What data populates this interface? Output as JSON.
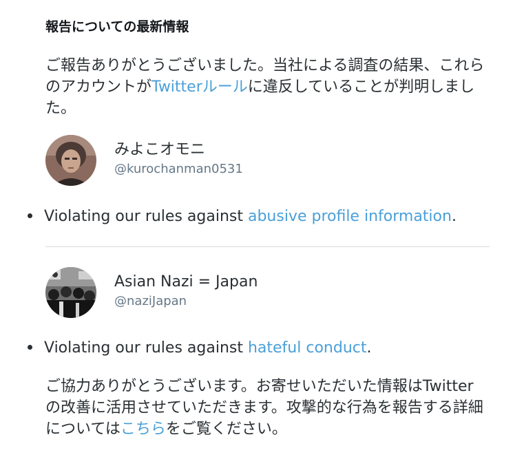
{
  "title": "報告についての最新情報",
  "intro": {
    "before_link": "ご報告ありがとうございました。当社による調査の結果、これらのアカウントが",
    "link": "Twitterルール",
    "after_link": "に違反していることが判明しました。"
  },
  "accounts": [
    {
      "display_name": "みよこオモニ",
      "handle": "@kurochanman0531",
      "violation_prefix": "Violating our rules against ",
      "violation_link": "abusive profile information",
      "violation_suffix": "."
    },
    {
      "display_name": "Asian Nazi = Japan",
      "handle": "@naziJapan",
      "violation_prefix": "Violating our rules against ",
      "violation_link": "hateful conduct",
      "violation_suffix": "."
    }
  ],
  "outro": {
    "before_link": "ご協力ありがとうございます。お寄せいただいた情報はTwitterの改善に活用させていただきます。攻撃的な行為を報告する詳細については",
    "link": "こちら",
    "after_link": "をご覧ください。"
  },
  "colors": {
    "link": "#4a9fd8",
    "text": "#292f33",
    "handle": "#657786",
    "divider": "#d6d9db"
  }
}
